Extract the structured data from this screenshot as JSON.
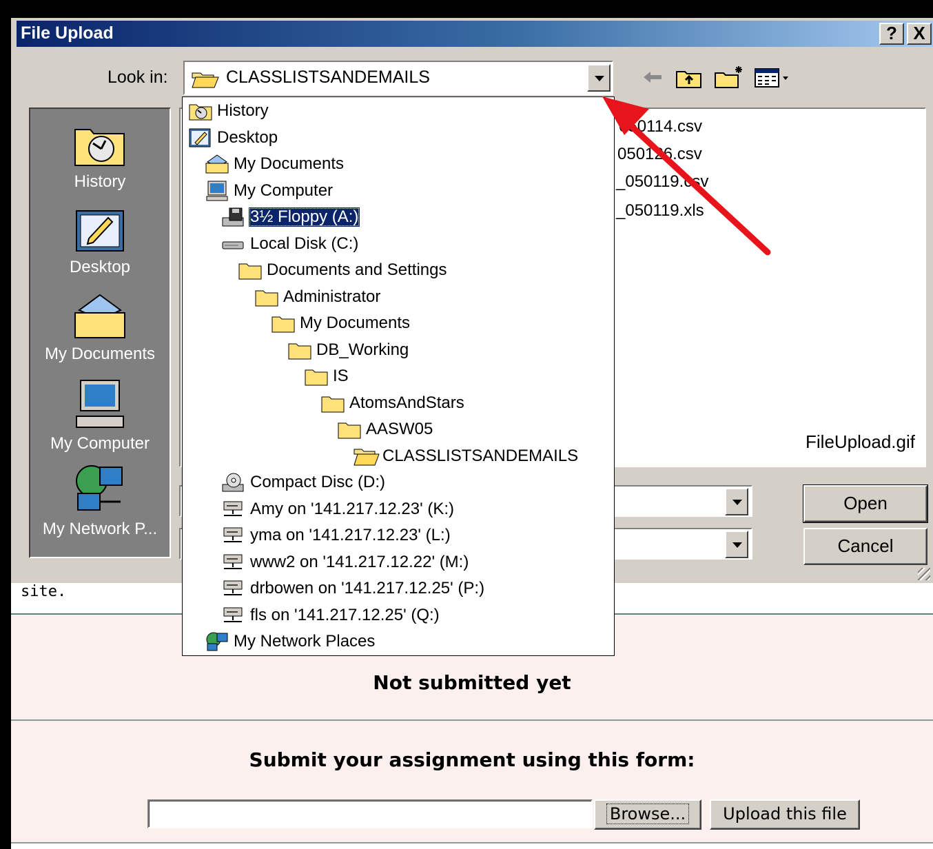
{
  "dialog": {
    "title": "File Upload",
    "help_label": "?",
    "close_label": "X",
    "look_in_label": "Look in:",
    "look_in_value": "CLASSLISTSANDEMAILS",
    "places": [
      {
        "label": "History",
        "icon": "history-icon"
      },
      {
        "label": "Desktop",
        "icon": "desktop-icon"
      },
      {
        "label": "My Documents",
        "icon": "my-documents-icon"
      },
      {
        "label": "My Computer",
        "icon": "my-computer-icon"
      },
      {
        "label": "My Network P...",
        "icon": "my-network-places-icon"
      }
    ],
    "files": [
      "050114.csv",
      "050126.csv",
      "_050119.csv",
      "_050119.xls"
    ],
    "file_name_overlay": "FileUpload.gif",
    "open_label": "Open",
    "cancel_label": "Cancel"
  },
  "dropdown": {
    "items": [
      {
        "label": "History",
        "icon": "history-icon",
        "level": 0
      },
      {
        "label": "Desktop",
        "icon": "desktop-icon",
        "level": 0
      },
      {
        "label": "My Documents",
        "icon": "my-documents-icon",
        "level": 1
      },
      {
        "label": "My Computer",
        "icon": "my-computer-icon",
        "level": 1
      },
      {
        "label": "3½ Floppy (A:)",
        "icon": "floppy-drive-icon",
        "level": 2,
        "selected": true
      },
      {
        "label": "Local Disk (C:)",
        "icon": "hard-disk-icon",
        "level": 2
      },
      {
        "label": "Documents and Settings",
        "icon": "folder-icon",
        "level": 3
      },
      {
        "label": "Administrator",
        "icon": "folder-icon",
        "level": 4
      },
      {
        "label": "My Documents",
        "icon": "folder-icon",
        "level": 5
      },
      {
        "label": "DB_Working",
        "icon": "folder-icon",
        "level": 6
      },
      {
        "label": "IS",
        "icon": "folder-icon",
        "level": 7
      },
      {
        "label": "AtomsAndStars",
        "icon": "folder-icon",
        "level": 8
      },
      {
        "label": "AASW05",
        "icon": "folder-icon",
        "level": 9
      },
      {
        "label": "CLASSLISTSANDEMAILS",
        "icon": "open-folder-icon",
        "level": 10
      },
      {
        "label": "Compact Disc (D:)",
        "icon": "cd-drive-icon",
        "level": 2
      },
      {
        "label": "Amy on '141.217.12.23' (K:)",
        "icon": "network-drive-icon",
        "level": 2
      },
      {
        "label": "yma on '141.217.12.23' (L:)",
        "icon": "network-drive-icon",
        "level": 2
      },
      {
        "label": "www2 on '141.217.12.22' (M:)",
        "icon": "network-drive-icon",
        "level": 2
      },
      {
        "label": "drbowen on '141.217.12.25' (P:)",
        "icon": "network-drive-icon",
        "level": 2
      },
      {
        "label": "fls on '141.217.12.25' (Q:)",
        "icon": "network-drive-icon",
        "level": 2
      },
      {
        "label": "My Network Places",
        "icon": "my-network-places-icon",
        "level": 1
      }
    ]
  },
  "page": {
    "text_fragment": "site.",
    "status": "Not submitted yet",
    "form_title": "Submit your assignment using this form:",
    "browse_label": "Browse...",
    "upload_label": "Upload this file"
  },
  "colors": {
    "titlebar_start": "#0a246a",
    "titlebar_end": "#a6caf0",
    "dialog_bg": "#d4d0c8",
    "selection": "#0a246a",
    "arrow": "#e8141b",
    "page_pink": "#fbf0ee"
  }
}
